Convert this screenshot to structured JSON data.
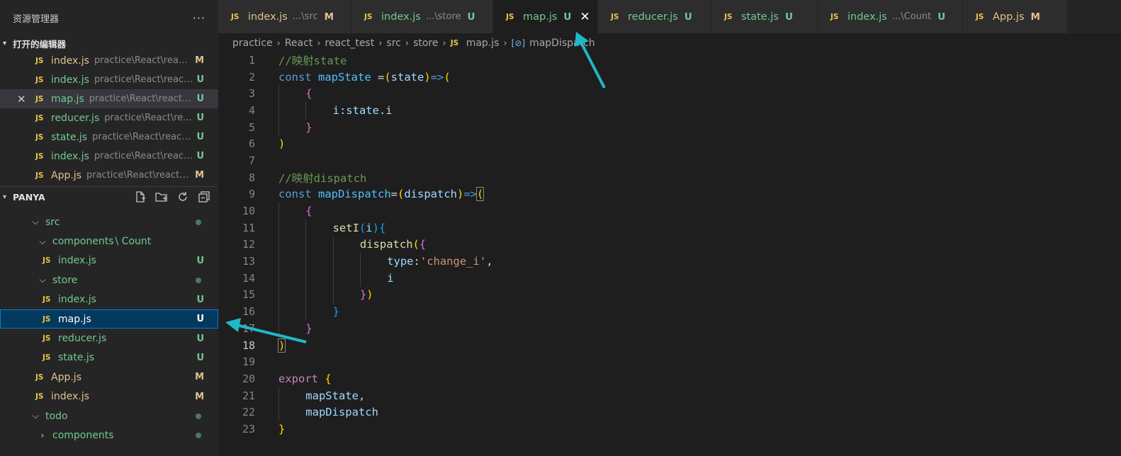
{
  "explorer": {
    "title": "资源管理器",
    "more": "···",
    "open_editors_title": "打开的编辑器",
    "open_editors": [
      {
        "name": "index.js",
        "path": "practice\\React\\react...",
        "status": "M",
        "active": false
      },
      {
        "name": "index.js",
        "path": "practice\\React\\react...",
        "status": "U",
        "active": false
      },
      {
        "name": "map.js",
        "path": "practice\\React\\react_...",
        "status": "U",
        "active": true
      },
      {
        "name": "reducer.js",
        "path": "practice\\React\\re...",
        "status": "U",
        "active": false
      },
      {
        "name": "state.js",
        "path": "practice\\React\\react...",
        "status": "U",
        "active": false
      },
      {
        "name": "index.js",
        "path": "practice\\React\\react...",
        "status": "U",
        "active": false
      },
      {
        "name": "App.js",
        "path": "practice\\React\\react_...",
        "status": "M",
        "active": false
      }
    ],
    "close_glyph": "✕",
    "folder_title": "PANYA",
    "tree": [
      {
        "label": "src",
        "type": "folder",
        "chev": "⌵",
        "dot": true,
        "color": "U"
      },
      {
        "label": "components",
        "sub": "\\ Count",
        "type": "folder",
        "chev": "⌵",
        "dot": false,
        "color": "U"
      },
      {
        "label": "index.js",
        "type": "file",
        "status": "U"
      },
      {
        "label": "store",
        "type": "folder",
        "chev": "⌵",
        "dot": true,
        "color": "U"
      },
      {
        "label": "index.js",
        "type": "file",
        "status": "U"
      },
      {
        "label": "map.js",
        "type": "file",
        "status": "U",
        "selected": true
      },
      {
        "label": "reducer.js",
        "type": "file",
        "status": "U"
      },
      {
        "label": "state.js",
        "type": "file",
        "status": "U"
      },
      {
        "label": "App.js",
        "type": "file",
        "status": "M"
      },
      {
        "label": "index.js",
        "type": "file",
        "status": "M"
      },
      {
        "label": "todo",
        "type": "folder",
        "chev": "⌵",
        "dot": true,
        "color": "U"
      },
      {
        "label": "components",
        "type": "folder",
        "chev": "›",
        "dot": true,
        "color": "U"
      }
    ]
  },
  "tabs": [
    {
      "name": "index.js",
      "desc": "...\\src",
      "status": "M"
    },
    {
      "name": "index.js",
      "desc": "...\\store",
      "status": "U"
    },
    {
      "name": "map.js",
      "desc": "",
      "status": "U",
      "active": true,
      "close": "✕"
    },
    {
      "name": "reducer.js",
      "desc": "",
      "status": "U"
    },
    {
      "name": "state.js",
      "desc": "",
      "status": "U"
    },
    {
      "name": "index.js",
      "desc": "...\\Count",
      "status": "U"
    },
    {
      "name": "App.js",
      "desc": "",
      "status": "M"
    }
  ],
  "js_badge": "JS",
  "breadcrumb": {
    "parts": [
      "practice",
      "React",
      "react_test",
      "src",
      "store",
      "map.js"
    ],
    "symbol_icon": "[⊘]",
    "symbol": "mapDispatch"
  },
  "editor": {
    "current_line": 18,
    "lines": [
      {
        "n": "1",
        "tokens": [
          [
            "c-com",
            "//映射state"
          ]
        ],
        "indent": 0
      },
      {
        "n": "2",
        "tokens": [
          [
            "c-kw",
            "const "
          ],
          [
            "c-const",
            "mapState"
          ],
          [
            "c-op",
            " ="
          ],
          [
            "b1",
            "("
          ],
          [
            "c-var",
            "state"
          ],
          [
            "b1",
            ")"
          ],
          [
            "c-kw",
            "=>"
          ],
          [
            "b1",
            "("
          ]
        ],
        "indent": 0
      },
      {
        "n": "3",
        "tokens": [
          [
            "b2",
            "{"
          ]
        ],
        "indent": 1
      },
      {
        "n": "4",
        "tokens": [
          [
            "c-var",
            "i"
          ],
          [
            "c-op",
            ":"
          ],
          [
            "c-var",
            "state"
          ],
          [
            "c-op",
            "."
          ],
          [
            "c-var",
            "i"
          ]
        ],
        "indent": 2
      },
      {
        "n": "5",
        "tokens": [
          [
            "b2",
            "}"
          ]
        ],
        "indent": 1
      },
      {
        "n": "6",
        "tokens": [
          [
            "b1",
            ")"
          ]
        ],
        "indent": 0
      },
      {
        "n": "7",
        "tokens": [],
        "indent": 0
      },
      {
        "n": "8",
        "tokens": [
          [
            "c-com",
            "//映射dispatch"
          ]
        ],
        "indent": 0
      },
      {
        "n": "9",
        "tokens": [
          [
            "c-kw",
            "const "
          ],
          [
            "c-const",
            "mapDispatch"
          ],
          [
            "c-op",
            "="
          ],
          [
            "b1",
            "("
          ],
          [
            "c-var",
            "dispatch"
          ],
          [
            "b1",
            ")"
          ],
          [
            "c-kw",
            "=>"
          ],
          [
            "b1 bm",
            "("
          ]
        ],
        "indent": 0
      },
      {
        "n": "10",
        "tokens": [
          [
            "b2",
            "{"
          ]
        ],
        "indent": 1
      },
      {
        "n": "11",
        "tokens": [
          [
            "c-fn",
            "setI"
          ],
          [
            "b3",
            "("
          ],
          [
            "c-var",
            "i"
          ],
          [
            "b3",
            ")"
          ],
          [
            "b3",
            "{"
          ]
        ],
        "indent": 2
      },
      {
        "n": "12",
        "tokens": [
          [
            "c-fn",
            "dispatch"
          ],
          [
            "b1",
            "("
          ],
          [
            "b2",
            "{"
          ]
        ],
        "indent": 3
      },
      {
        "n": "13",
        "tokens": [
          [
            "c-var",
            "type"
          ],
          [
            "c-op",
            ":"
          ],
          [
            "c-str",
            "'change_i'"
          ],
          [
            "c-op",
            ","
          ]
        ],
        "indent": 4
      },
      {
        "n": "14",
        "tokens": [
          [
            "c-var",
            "i"
          ]
        ],
        "indent": 4
      },
      {
        "n": "15",
        "tokens": [
          [
            "b2",
            "}"
          ],
          [
            "b1",
            ")"
          ]
        ],
        "indent": 3
      },
      {
        "n": "16",
        "tokens": [
          [
            "b3",
            "}"
          ]
        ],
        "indent": 2
      },
      {
        "n": "17",
        "tokens": [
          [
            "b2",
            "}"
          ]
        ],
        "indent": 1
      },
      {
        "n": "18",
        "tokens": [
          [
            "b1 bm",
            ")"
          ]
        ],
        "indent": 0
      },
      {
        "n": "19",
        "tokens": [],
        "indent": 0
      },
      {
        "n": "20",
        "tokens": [
          [
            "c-kw2",
            "export "
          ],
          [
            "b1",
            "{"
          ]
        ],
        "indent": 0
      },
      {
        "n": "21",
        "tokens": [
          [
            "c-var",
            "mapState"
          ],
          [
            "c-op",
            ","
          ]
        ],
        "indent": 1
      },
      {
        "n": "22",
        "tokens": [
          [
            "c-var",
            "mapDispatch"
          ]
        ],
        "indent": 1
      },
      {
        "n": "23",
        "tokens": [
          [
            "b1",
            "}"
          ]
        ],
        "indent": 0
      }
    ]
  },
  "colors": {
    "modified": "#e2c08d",
    "untracked": "#73c991",
    "selection": "#04395e",
    "annotation_arrow": "#1fb8c8"
  }
}
